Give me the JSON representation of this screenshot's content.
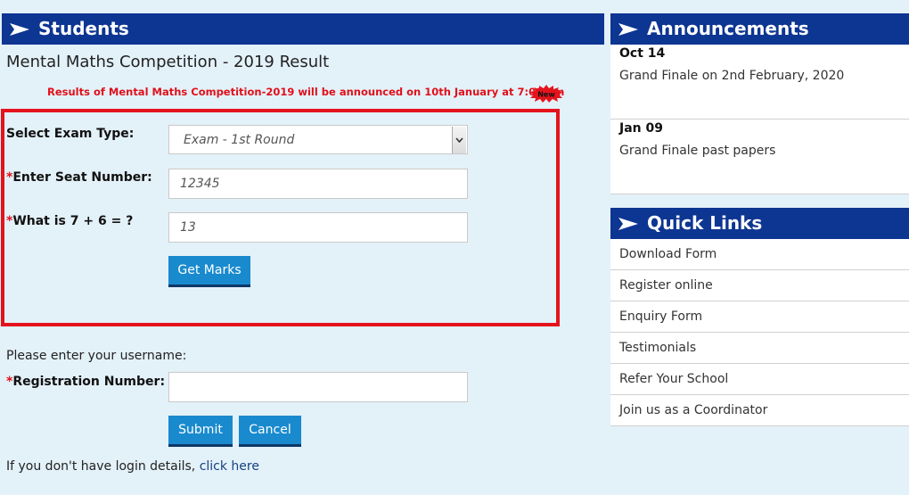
{
  "students": {
    "header": "Students"
  },
  "page_title": "Mental Maths Competition - 2019 Result",
  "notice": "Results of Mental Maths Competition-2019 will be announced on 10th January at 7:00 pm",
  "new_badge": "New",
  "exam_form": {
    "exam_type_label": "Select Exam Type:",
    "exam_type_value": "Exam - 1st Round",
    "seat_required": "*",
    "seat_label": "Enter Seat Number:",
    "seat_value": "12345",
    "captcha_required": "*",
    "captcha_label": "What is 7 + 6 = ?",
    "captcha_value": "13",
    "get_marks_button": "Get Marks"
  },
  "login_form": {
    "username_prompt": "Please enter your username:",
    "reg_required": "*",
    "reg_label": "Registration Number:",
    "reg_value": "",
    "submit_button": "Submit",
    "cancel_button": "Cancel",
    "no_login_text": "If you don't have login details,",
    "click_here_link": "click here"
  },
  "announcements": {
    "header": "Announcements",
    "items": [
      {
        "date": "Oct 14",
        "text": "Grand Finale on 2nd February, 2020"
      },
      {
        "date": "Jan 09",
        "text": "Grand Finale past papers"
      }
    ]
  },
  "quick_links": {
    "header": "Quick Links",
    "items": [
      "Download Form",
      "Register online",
      "Enquiry Form",
      "Testimonials",
      "Refer Your School",
      "Join us as a Coordinator"
    ]
  },
  "colors": {
    "header_bar": "#0d3592",
    "button": "#1a8ace",
    "highlight_border": "#e4131c",
    "notice_text": "#e0101a",
    "background": "#e3f1f9"
  },
  "icons": {
    "header_arrow": "arrow-icon",
    "select_arrow": "chevron-down-icon",
    "new_badge": "new-starburst-icon"
  }
}
